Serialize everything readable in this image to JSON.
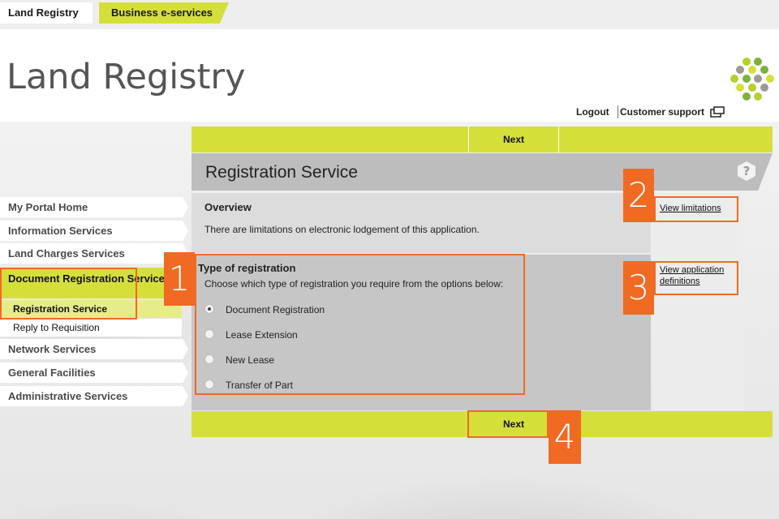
{
  "top_tabs": {
    "land_registry": "Land Registry",
    "business_eservices": "Business e-services"
  },
  "brand": {
    "logo_text": "Land Registry",
    "accent_color": "#d5df3a",
    "callout_color": "#f06a23"
  },
  "utility": {
    "logout": "Logout",
    "customer_support": "Customer support"
  },
  "nav": {
    "items": [
      {
        "label": "My Portal Home"
      },
      {
        "label": "Information Services"
      },
      {
        "label": "Land Charges Services"
      },
      {
        "label": "Document Registration Service"
      },
      {
        "label": "Network Services"
      },
      {
        "label": "General Facilities"
      },
      {
        "label": "Administrative Services"
      }
    ],
    "subitems": [
      {
        "label": "Registration Service"
      },
      {
        "label": "Reply to Requisition"
      }
    ]
  },
  "main": {
    "next_top": "Next",
    "next_bottom": "Next",
    "title": "Registration Service",
    "overview_heading": "Overview",
    "overview_text": "There are limitations on electronic lodgement of this application.",
    "type_heading": "Type of registration",
    "type_instruction": "Choose which type of registration you require from the options below:",
    "options": [
      {
        "label": "Document Registration",
        "selected": true
      },
      {
        "label": "Lease Extension",
        "selected": false
      },
      {
        "label": "New Lease",
        "selected": false
      },
      {
        "label": "Transfer of Part",
        "selected": false
      }
    ],
    "view_limitations": "View limitations",
    "view_definitions_line1": "View application",
    "view_definitions_line2": "definitions"
  },
  "callouts": {
    "one": "1",
    "two": "2",
    "three": "3",
    "four": "4"
  }
}
